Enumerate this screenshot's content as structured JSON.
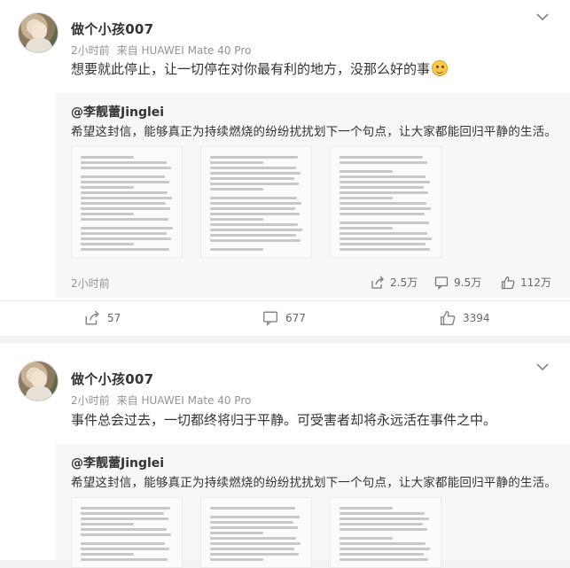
{
  "post1": {
    "username": "做个小孩007",
    "time": "2小时前",
    "source": "来自 HUAWEI Mate 40 Pro",
    "content": "想要就此停止，让一切停在对你最有利的地方，没那么好的事",
    "emoji_icon": "smile-emoji-icon",
    "repost": {
      "user": "@李靓蕾Jinglei",
      "text": "希望这封信，能够真正为持续燃烧的纷纷扰扰划下一个句点，让大家都能回归平静的生活。",
      "time": "2小时前",
      "share_count": "2.5万",
      "comment_count": "9.5万",
      "like_count": "112万"
    },
    "share_count": "57",
    "comment_count": "677",
    "like_count": "3394"
  },
  "post2": {
    "username": "做个小孩007",
    "time": "2小时前",
    "source": "来自 HUAWEI Mate 40 Pro",
    "content": "事件总会过去，一切都终将归于平静。可受害者却将永远活在事件之中。",
    "repost": {
      "user": "@李靓蕾Jinglei",
      "text": "希望这封信，能够真正为持续燃烧的纷纷扰扰划下一个句点，让大家都能回归平静的生活。"
    }
  },
  "colors": {
    "background": "#f2f2f2",
    "card": "#ffffff",
    "repost_bg": "#f7f7f7",
    "meta": "#939393"
  }
}
